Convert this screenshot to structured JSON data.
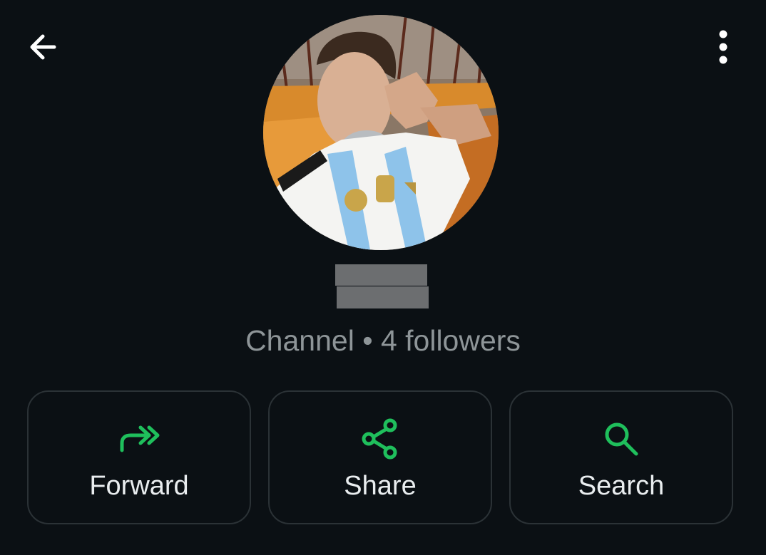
{
  "header": {
    "back_icon": "arrow-left-icon",
    "menu_icon": "more-vertical-icon"
  },
  "profile": {
    "subtitle": "Channel • 4 followers"
  },
  "actions": [
    {
      "label": "Forward",
      "icon": "forward-icon"
    },
    {
      "label": "Share",
      "icon": "share-icon"
    },
    {
      "label": "Search",
      "icon": "search-icon"
    }
  ],
  "colors": {
    "background": "#0b1014",
    "accent": "#1fbf5c",
    "text": "#e9edef",
    "muted": "#8e9598",
    "card_border": "#2b3236"
  }
}
